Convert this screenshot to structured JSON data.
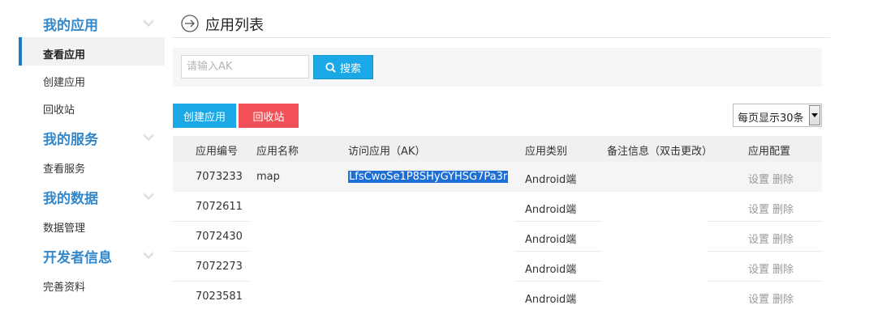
{
  "sidebar": {
    "sections": [
      {
        "title": "我的应用",
        "items": [
          "查看应用",
          "创建应用",
          "回收站"
        ]
      },
      {
        "title": "我的服务",
        "items": [
          "查看服务"
        ]
      },
      {
        "title": "我的数据",
        "items": [
          "数据管理"
        ]
      },
      {
        "title": "开发者信息",
        "items": [
          "完善资料"
        ]
      }
    ]
  },
  "header": {
    "title": "应用列表",
    "icon": "arrow-right-circle-icon"
  },
  "search": {
    "placeholder": "请输入AK",
    "value": "",
    "button_label": "搜索",
    "button_icon": "search-icon"
  },
  "actions": {
    "create_label": "创建应用",
    "recycle_label": "回收站"
  },
  "page_size": {
    "selected": "每页显示30条"
  },
  "table": {
    "columns": [
      "应用编号",
      "应用名称",
      "访问应用（AK）",
      "应用类别",
      "备注信息（双击更改）",
      "应用配置"
    ],
    "rows": [
      {
        "id": "7073233",
        "name": "map",
        "ak": "LfsCwoSe1P8SHyGYHSG7Pa3r",
        "type": "Android端",
        "note": "",
        "ops": [
          "设置",
          "删除"
        ]
      },
      {
        "id": "7072611",
        "name": "",
        "ak": "",
        "type": "Android端",
        "note": "",
        "ops": [
          "设置",
          "删除"
        ]
      },
      {
        "id": "7072430",
        "name": "",
        "ak": "",
        "type": "Android端",
        "note": "",
        "ops": [
          "设置",
          "删除"
        ]
      },
      {
        "id": "7072273",
        "name": "",
        "ak": "",
        "type": "Android端",
        "note": "",
        "ops": [
          "设置",
          "删除"
        ]
      },
      {
        "id": "7023581",
        "name": "",
        "ak": "",
        "type": "Android端",
        "note": "",
        "ops": [
          "设置",
          "删除"
        ]
      }
    ]
  },
  "colors": {
    "accent": "#1aa9e6",
    "danger": "#f25057",
    "section_title": "#3388cc",
    "active_border": "#1f7bc1"
  }
}
